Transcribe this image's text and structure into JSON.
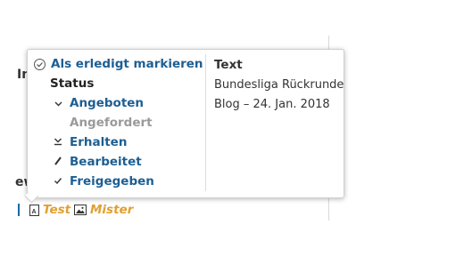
{
  "background": {
    "left_fragment_1": "In",
    "left_fragment_2": "ew"
  },
  "popup": {
    "left": {
      "mark_done": {
        "label": "Als erledigt markieren",
        "icon": "check-circle-icon"
      },
      "status_heading": "Status",
      "status_items": [
        {
          "label": "Angeboten",
          "icon": "chevron-down-icon",
          "state": "active"
        },
        {
          "label": "Angefordert",
          "icon": "",
          "state": "disabled"
        },
        {
          "label": "Erhalten",
          "icon": "download-icon",
          "state": "active"
        },
        {
          "label": "Bearbeitet",
          "icon": "pencil-icon",
          "state": "active"
        },
        {
          "label": "Freigegeben",
          "icon": "checkmark-icon",
          "state": "active"
        }
      ]
    },
    "right": {
      "heading": "Text",
      "lines": [
        "Bundesliga Rückrunde",
        "Blog – 24. Jan. 2018"
      ]
    }
  },
  "footer": {
    "items": [
      {
        "label": "Test",
        "icon": "text-file-icon"
      },
      {
        "label": "Mister",
        "icon": "image-file-icon"
      }
    ]
  },
  "colors": {
    "link_blue": "#1d5f93",
    "disabled_grey": "#9a9a9a",
    "accent_orange": "#e0a030"
  }
}
